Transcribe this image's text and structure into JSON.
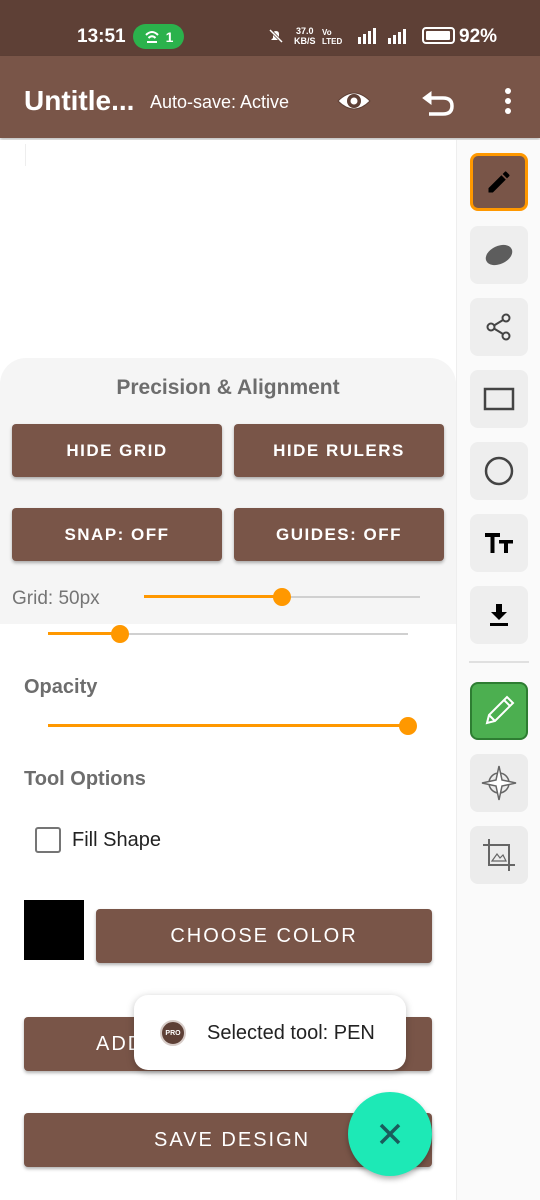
{
  "status_bar": {
    "time": "13:51",
    "hotspot_count": "1",
    "net_speed": "37.0",
    "net_unit": "KB/S",
    "battery": "92%"
  },
  "app_bar": {
    "title": "Untitle...",
    "autosave": "Auto-save: Active",
    "icons": [
      "eye-icon",
      "undo-icon",
      "more-vert-icon"
    ]
  },
  "toolbar": {
    "tools": [
      "pen",
      "eraser",
      "share",
      "rectangle",
      "circle",
      "text",
      "download",
      "pencil-green",
      "compass",
      "crop"
    ],
    "active_tool": "pen"
  },
  "precision_panel": {
    "title": "Precision & Alignment",
    "hide_grid_label": "HIDE GRID",
    "hide_rulers_label": "HIDE RULERS",
    "snap_label": "SNAP: OFF",
    "guides_label": "GUIDES: OFF",
    "grid_label": "Grid: 50px",
    "grid_slider_fraction": 0.5
  },
  "options": {
    "size_slider_fraction": 0.2,
    "opacity_label": "Opacity",
    "opacity_fraction": 1.0,
    "tool_options_label": "Tool Options",
    "fill_shape_label": "Fill Shape",
    "fill_shape_checked": false,
    "selected_color": "#000000",
    "choose_color_label": "CHOOSE COLOR",
    "add_button_label": "ADD",
    "save_design_label": "SAVE DESIGN"
  },
  "toast": {
    "badge": "PRO",
    "message": "Selected tool: PEN"
  },
  "colors": {
    "brown": "#795548",
    "status_brown": "#5e4036",
    "accent_orange": "#ff9800",
    "fab_teal": "#1de9b6",
    "green_tool": "#4caf50"
  }
}
